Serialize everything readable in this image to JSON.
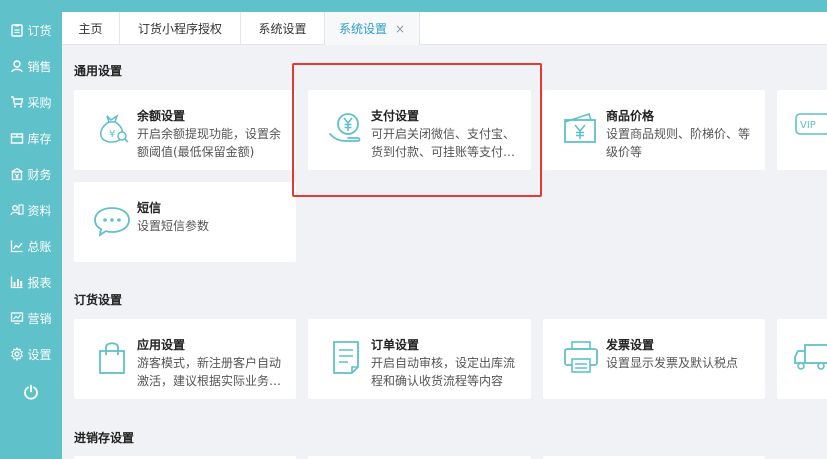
{
  "sidebar": {
    "items": [
      {
        "label": "订货",
        "icon": "clipboard-icon"
      },
      {
        "label": "销售",
        "icon": "person-icon"
      },
      {
        "label": "采购",
        "icon": "cart-icon"
      },
      {
        "label": "库存",
        "icon": "box-icon"
      },
      {
        "label": "财务",
        "icon": "finance-icon"
      },
      {
        "label": "资料",
        "icon": "profile-card-icon"
      },
      {
        "label": "总账",
        "icon": "ledger-chart-icon"
      },
      {
        "label": "报表",
        "icon": "report-chart-icon"
      },
      {
        "label": "营销",
        "icon": "marketing-icon"
      },
      {
        "label": "设置",
        "icon": "gear-icon"
      }
    ],
    "power_icon": "power-icon"
  },
  "tabs": [
    {
      "label": "主页"
    },
    {
      "label": "订货小程序授权"
    },
    {
      "label": "系统设置"
    },
    {
      "label": "系统设置",
      "active": true,
      "close": "×"
    }
  ],
  "sections": {
    "general": {
      "title": "通用设置",
      "cards": [
        {
          "title": "余额设置",
          "desc": "开启余额提现功能，设置余额阈值(最低保留金额)",
          "icon": "money-bag-icon"
        },
        {
          "title": "支付设置",
          "desc": "可开启关闭微信、支付宝、货到付款、可挂账等支付方式",
          "icon": "yuan-hand-icon"
        },
        {
          "title": "商品价格",
          "desc": "设置商品规则、阶梯价、等级价等",
          "icon": "price-tag-icon"
        },
        {
          "title": "",
          "desc": "",
          "icon": "vip-icon",
          "badge": "VIP"
        },
        {
          "title": "短信",
          "desc": "设置短信参数",
          "icon": "chat-bubble-icon"
        }
      ]
    },
    "order": {
      "title": "订货设置",
      "cards": [
        {
          "title": "应用设置",
          "desc": "游客模式，新注册客户自动激活，建议根据实际业务设置",
          "icon": "shopping-bag-icon"
        },
        {
          "title": "订单设置",
          "desc": "开启自动审核，设定出库流程和确认收货流程等内容",
          "icon": "document-icon"
        },
        {
          "title": "发票设置",
          "desc": "设置显示发票及默认税点",
          "icon": "printer-icon"
        },
        {
          "title": "",
          "desc": "",
          "icon": "truck-icon"
        }
      ]
    },
    "inventory": {
      "title": "进销存设置"
    }
  },
  "colors": {
    "sidebar": "#5fc1c9",
    "icon": "#5fc1c9",
    "active_tab": "#2d9dc8",
    "highlight": "#e53935"
  }
}
